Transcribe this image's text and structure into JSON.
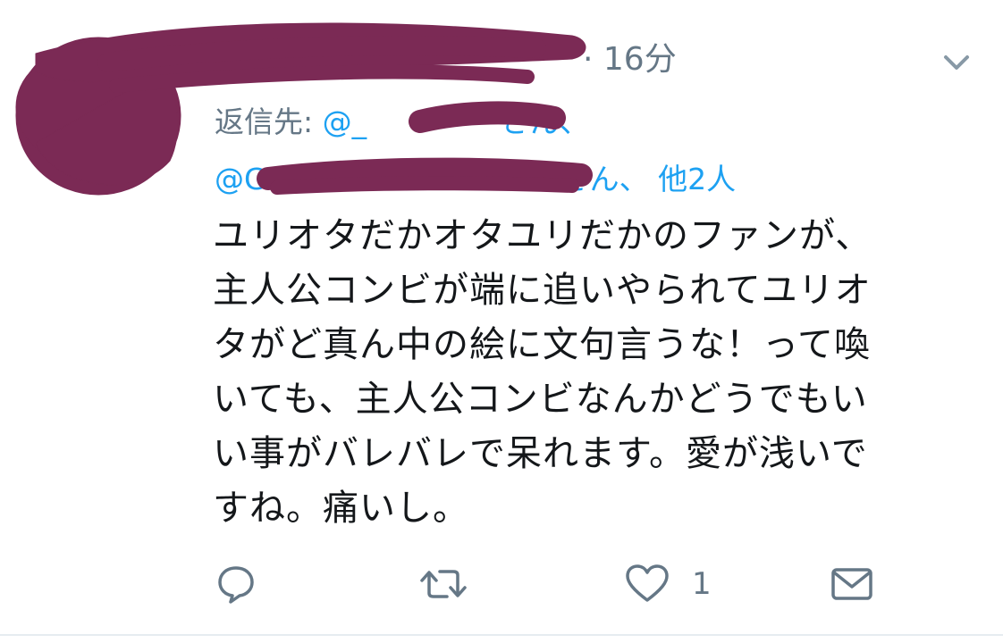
{
  "tweet": {
    "time": "· 16分",
    "reply_prefix": "返信先:",
    "reply_line1_start": "@_",
    "reply_line1_end": "さん、",
    "reply_line2_start": "@G",
    "reply_line2_end": "さん、 他2人",
    "body_lines": [
      "ユリオタだかオタユリだかのファンが、",
      "主人公コンビが端に追いやられてユリオ",
      "タがど真ん中の絵に文句言うな！って喚",
      "いても、主人公コンビなんかどうでもい",
      "い事がバレバレで呆れます。愛が浅いで",
      "すね。痛いし。"
    ]
  },
  "actions": {
    "reply_icon": "reply-icon",
    "retweet_icon": "retweet-icon",
    "like_icon": "heart-icon",
    "like_count": "1",
    "dm_icon": "envelope-icon"
  },
  "colors": {
    "link": "#1da1f2",
    "muted": "#657786",
    "text": "#14171a",
    "redaction": "#7b2a55"
  }
}
